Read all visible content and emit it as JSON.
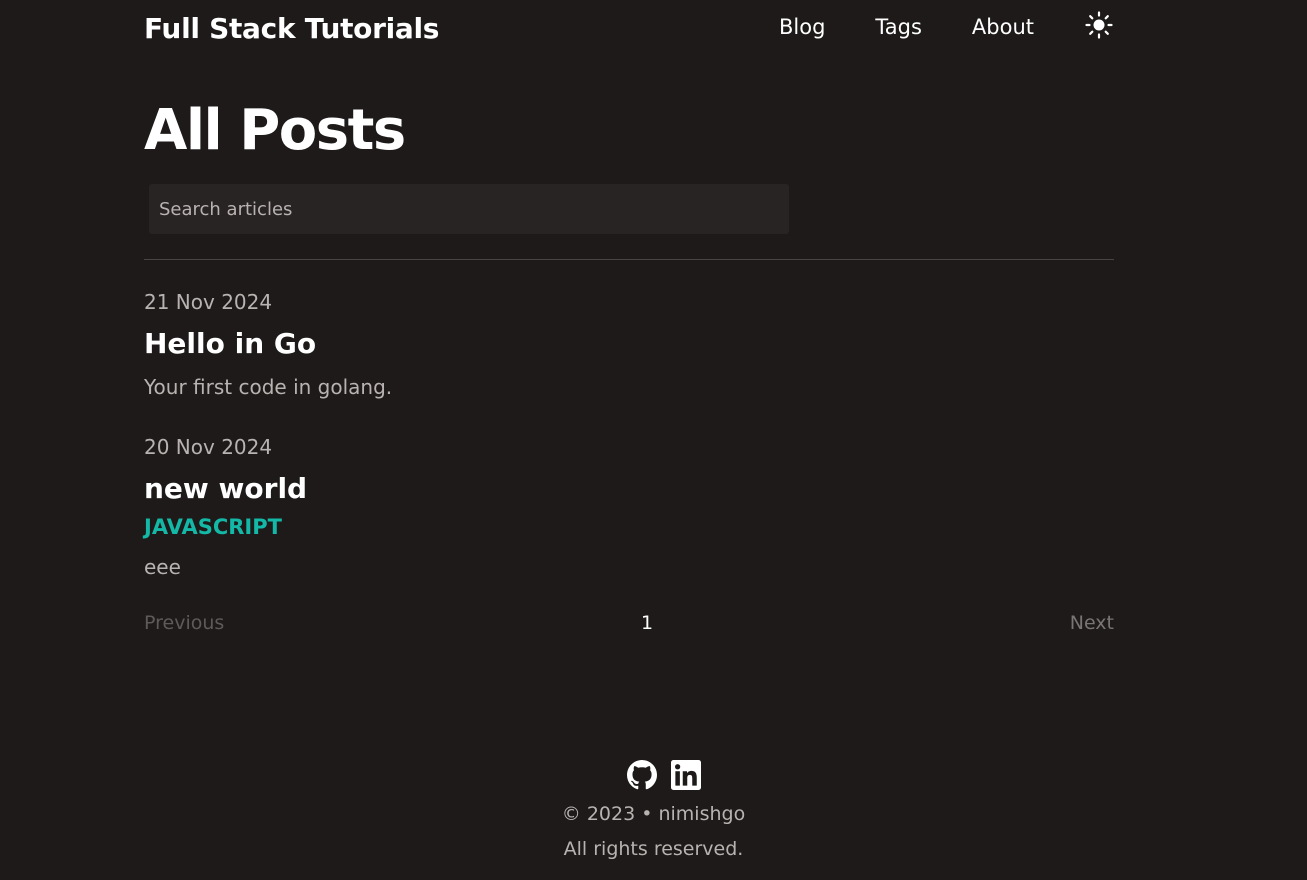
{
  "header": {
    "site_title": "Full Stack Tutorials",
    "nav": [
      {
        "label": "Blog"
      },
      {
        "label": "Tags"
      },
      {
        "label": "About"
      }
    ],
    "theme_toggle_icon": "sun-icon"
  },
  "main": {
    "title": "All Posts",
    "search": {
      "placeholder": "Search articles",
      "value": ""
    },
    "posts": [
      {
        "date": "21 Nov 2024",
        "title": "Hello in Go",
        "tags": [],
        "summary": "Your first code in golang."
      },
      {
        "date": "20 Nov 2024",
        "title": "new world",
        "tags": [
          "JAVASCRIPT"
        ],
        "summary": "eee"
      }
    ],
    "pagination": {
      "previous": "Previous",
      "current_page": "1",
      "next": "Next"
    }
  },
  "footer": {
    "icons": [
      "github-icon",
      "linkedin-icon"
    ],
    "copyright": "© 2023 • nimishgo",
    "rights": "All rights reserved."
  },
  "colors": {
    "background": "#1d1a19",
    "text": "#ffffff",
    "muted": "#b8b3b1",
    "tag_accent": "#14b8a6",
    "search_bg": "#292424"
  }
}
